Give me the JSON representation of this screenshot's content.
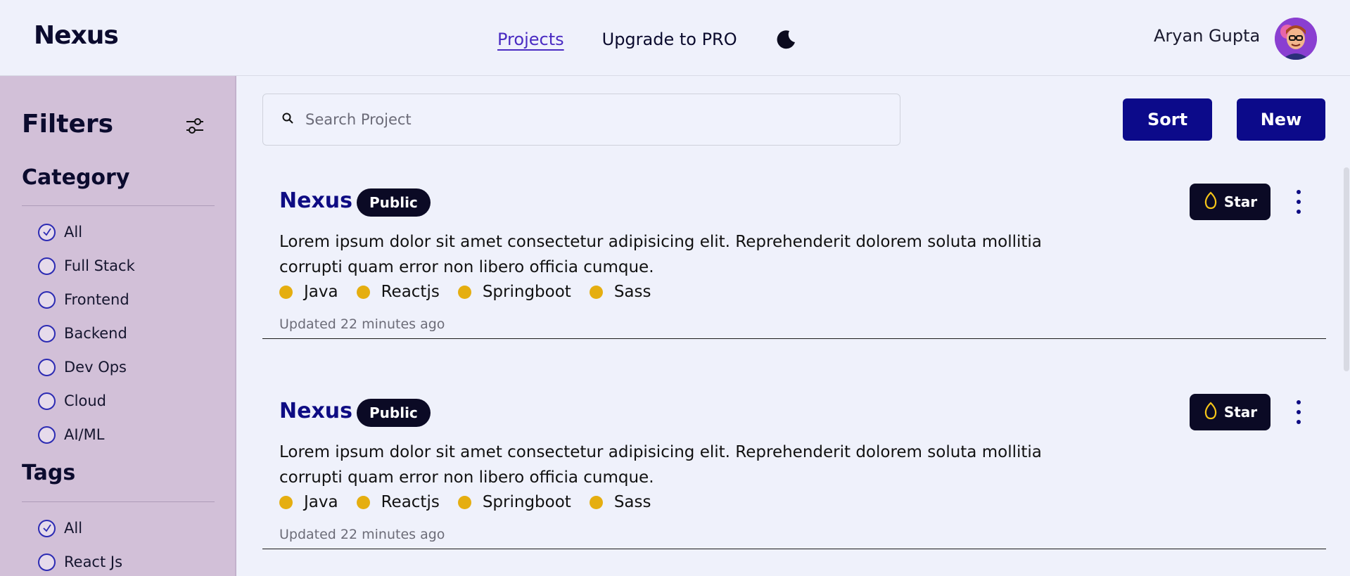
{
  "header": {
    "brand": "Nexus",
    "nav": {
      "projects": "Projects",
      "upgrade": "Upgrade to PRO"
    },
    "user_name": "Aryan Gupta"
  },
  "sidebar": {
    "title": "Filters",
    "category": {
      "title": "Category",
      "options": [
        {
          "label": "All",
          "checked": true
        },
        {
          "label": "Full Stack",
          "checked": false
        },
        {
          "label": "Frontend",
          "checked": false
        },
        {
          "label": "Backend",
          "checked": false
        },
        {
          "label": "Dev Ops",
          "checked": false
        },
        {
          "label": "Cloud",
          "checked": false
        },
        {
          "label": "AI/ML",
          "checked": false
        }
      ]
    },
    "tags": {
      "title": "Tags",
      "options": [
        {
          "label": "All",
          "checked": true
        },
        {
          "label": "React Js",
          "checked": false
        }
      ]
    }
  },
  "search": {
    "placeholder": "Search Project",
    "value": ""
  },
  "toolbar": {
    "sort_label": "Sort",
    "new_label": "New"
  },
  "projects": [
    {
      "title": "Nexus",
      "visibility": "Public",
      "description": "Lorem ipsum dolor sit amet consectetur adipisicing elit. Reprehenderit dolorem soluta mollitia corrupti quam error non libero officia cumque.",
      "techs": [
        "Java",
        "Reactjs",
        "Springboot",
        "Sass"
      ],
      "updated": "Updated 22 minutes ago",
      "star_label": "Star"
    },
    {
      "title": "Nexus",
      "visibility": "Public",
      "description": "Lorem ipsum dolor sit amet consectetur adipisicing elit. Reprehenderit dolorem soluta mollitia corrupti quam error non libero officia cumque.",
      "techs": [
        "Java",
        "Reactjs",
        "Springboot",
        "Sass"
      ],
      "updated": "Updated 22 minutes ago",
      "star_label": "Star"
    }
  ],
  "colors": {
    "accent": "#0c0a8a",
    "sidebar_bg": "#d2c0d8",
    "page_bg": "#eff1fb",
    "tech_dot": "#e5ae10",
    "badge_bg": "#0b0a25"
  }
}
